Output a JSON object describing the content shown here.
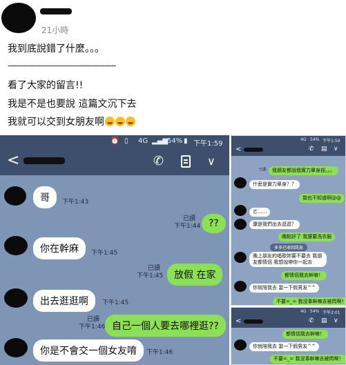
{
  "post": {
    "time": "21小時",
    "lines": [
      "我到底說錯了什麼。。。",
      "-----------------------------------------------",
      "看了大家的留言!!",
      "我是不是也要說 這篇文沉下去",
      "我就可以交到女朋友啊"
    ],
    "emojis": [
      "laughing-crying-emoji",
      "laughing-crying-emoji",
      "laughing-crying-emoji"
    ]
  },
  "main_chat": {
    "status": {
      "battery": "54%",
      "time": "下午1:59",
      "network": "4G"
    },
    "messages": [
      {
        "dir": "in",
        "text": "哥",
        "time": "下午1:43"
      },
      {
        "dir": "out",
        "text": "??",
        "read": "已讀",
        "time": "下午1:44"
      },
      {
        "dir": "in",
        "text": "你在幹麻",
        "time": "下午1:45"
      },
      {
        "dir": "out",
        "text": "放假 在家",
        "read": "已讀",
        "time": "下午1:45"
      },
      {
        "dir": "in",
        "text": "出去逛逛啊",
        "time": "下午1:45"
      },
      {
        "dir": "out",
        "text": "自己一個人要去哪裡逛??",
        "read": "已讀",
        "time": "下午1:46"
      },
      {
        "dir": "in",
        "text": "你是不會交一個女友唷",
        "time": "下午1:46"
      }
    ]
  },
  "mini_chat_1": {
    "status": {
      "battery": "54%",
      "time": "下午1:59",
      "network": "4G"
    },
    "messages": [
      {
        "dir": "out",
        "text": "我朋友都說我實力單身捏。。。"
      },
      {
        "dir": "in",
        "text": "什麼是實力單身？？"
      },
      {
        "dir": "out",
        "text": "我也不知道啊@@"
      },
      {
        "dir": "in",
        "text": "ㄜ......"
      },
      {
        "dir": "in",
        "text": "還是我們出去逛逛？"
      },
      {
        "dir": "out",
        "text": "晚點好了 我還要洗衣服"
      },
      {
        "dir": "date",
        "text": "多多已收回訊息"
      },
      {
        "dir": "in",
        "text": "晚上朋友約唱歌妳要不要去 我朋友都情侶 我想說帶你一起去"
      },
      {
        "dir": "out",
        "text": "都情侶我去幹嘛！"
      },
      {
        "dir": "in",
        "text": "你就陪我去 當一下假男友^^"
      },
      {
        "dir": "out",
        "text": "不要=_= 我沒事幹嘛去被閃啊！"
      }
    ]
  },
  "mini_chat_2": {
    "status": {
      "battery": "54%",
      "time": "下午2:01",
      "network": "4G"
    },
    "messages": [
      {
        "dir": "out",
        "text": "都情侶我去幹嘛！"
      },
      {
        "dir": "in",
        "text": "你就陪我去 當一下假男友^^"
      },
      {
        "dir": "out",
        "text": "不要=_= 我沒事幹嘛去被閃啊！"
      }
    ]
  },
  "meta_small": {
    "read": "已讀"
  }
}
